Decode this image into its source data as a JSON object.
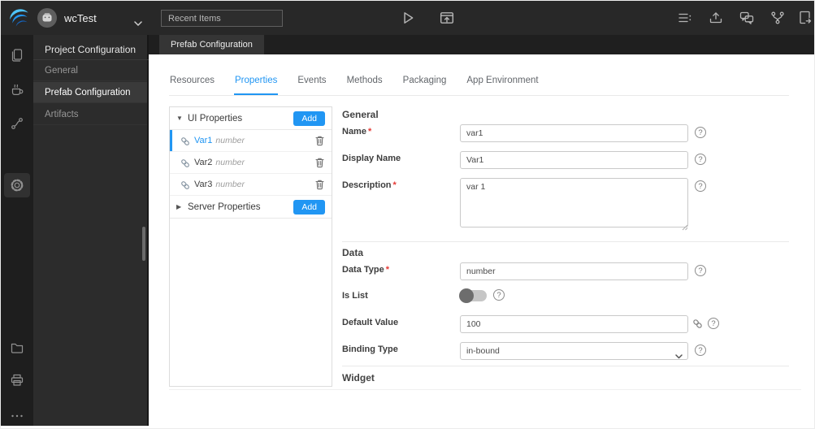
{
  "topbar": {
    "project_name": "wcTest",
    "recent_items_placeholder": "Recent Items"
  },
  "sidebar": {
    "title": "Project Configuration",
    "items": [
      {
        "label": "General"
      },
      {
        "label": "Prefab Configuration"
      },
      {
        "label": "Artifacts"
      }
    ]
  },
  "doc_tab": {
    "label": "Prefab Configuration"
  },
  "tabs": {
    "active": "Properties",
    "items": [
      {
        "label": "Resources"
      },
      {
        "label": "Properties"
      },
      {
        "label": "Events"
      },
      {
        "label": "Methods"
      },
      {
        "label": "Packaging"
      },
      {
        "label": "App Environment"
      }
    ]
  },
  "properties_panel": {
    "ui_group": {
      "caret": "▼",
      "label": "UI Properties",
      "add_label": "Add",
      "items": [
        {
          "name": "Var1",
          "type": "number",
          "selected": true
        },
        {
          "name": "Var2",
          "type": "number",
          "selected": false
        },
        {
          "name": "Var3",
          "type": "number",
          "selected": false
        }
      ]
    },
    "server_group": {
      "caret": "▶",
      "label": "Server Properties",
      "add_label": "Add"
    }
  },
  "form": {
    "required_marker": "*",
    "help_glyph": "?",
    "accent_color": "#2196f3",
    "general": {
      "title": "General",
      "name": {
        "label": "Name",
        "value": "var1"
      },
      "display_name": {
        "label": "Display Name",
        "value": "Var1"
      },
      "description": {
        "label": "Description",
        "value": "var 1"
      }
    },
    "data": {
      "title": "Data",
      "data_type": {
        "label": "Data Type",
        "value": "number"
      },
      "is_list": {
        "label": "Is List",
        "state": "off"
      },
      "default_value": {
        "label": "Default Value",
        "value": "100"
      },
      "binding_type": {
        "label": "Binding Type",
        "value": "in-bound"
      }
    },
    "widget": {
      "title": "Widget"
    }
  }
}
